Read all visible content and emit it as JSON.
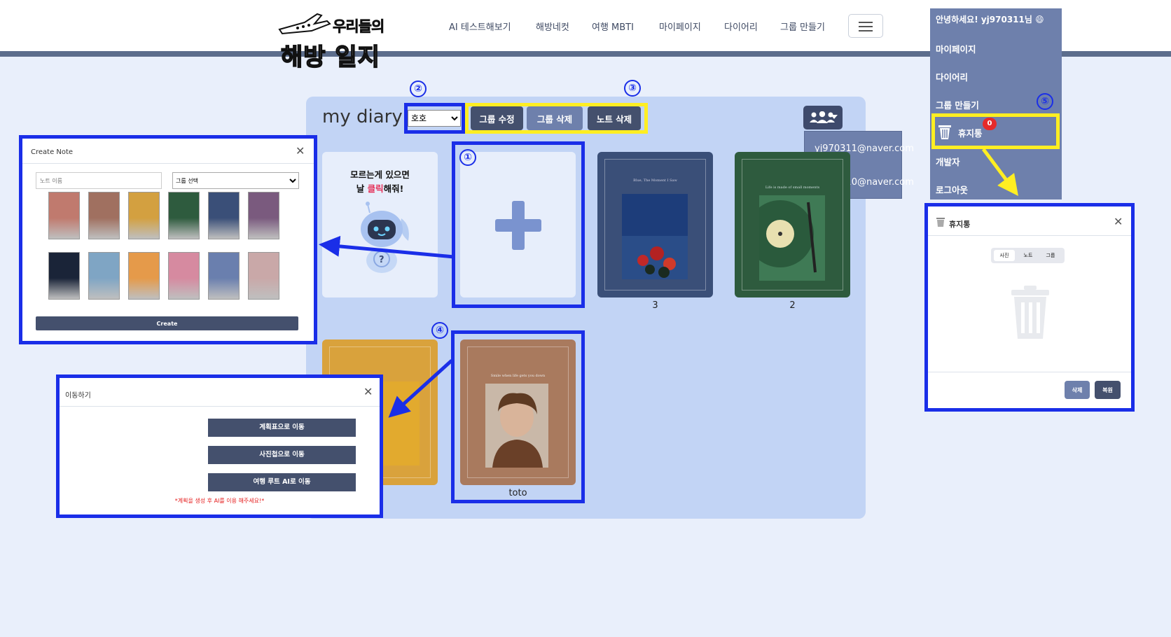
{
  "header": {
    "logo_line1": "우리들의",
    "logo_line2": "해방 일지",
    "nav": [
      "AI 테스트해보기",
      "해방네컷",
      "여행 MBTI",
      "마이페이지",
      "다이어리",
      "그룹 만들기"
    ]
  },
  "user_menu": {
    "greeting": "안녕하세요! yj970311님 😄",
    "items": [
      "마이페이지",
      "다이어리",
      "그룹 만들기",
      "휴지통",
      "개발자",
      "로그아웃"
    ],
    "trash_badge": "0"
  },
  "diary": {
    "title": "my diary",
    "group_select_value": "호호",
    "buttons": {
      "edit_group": "그룹 수정",
      "delete_group": "그룹 삭제",
      "delete_note": "노트 삭제"
    },
    "members": [
      "yj970311@naver.com",
      "kmy9810@naver.com"
    ],
    "helper_card": {
      "line1": "모르는게 있으면",
      "line2_pre": "날 ",
      "line2_hl": "클릭",
      "line2_post": "해줘!"
    },
    "notes": [
      {
        "caption": "3",
        "color": "#3a4f78",
        "small_text": "Blue, The Moment I Saw"
      },
      {
        "caption": "2",
        "color": "#2e5b3e",
        "small_text": "Life is made of small moments"
      },
      {
        "caption": "toto",
        "color": "#a97a5e",
        "small_text": "Smile when life gets you down"
      }
    ]
  },
  "annotations": [
    "①",
    "②",
    "③",
    "④",
    "⑤"
  ],
  "create_note_modal": {
    "title": "Create Note",
    "name_placeholder": "노트 이름",
    "group_placeholder": "그룹 선택",
    "create_label": "Create",
    "cover_colors": [
      "#c07a6e",
      "#a07060",
      "#d3a040",
      "#2e5b3e",
      "#3a4f78",
      "#7a5a7e",
      "#1a2438",
      "#7fa5c4",
      "#e59a4a",
      "#d68aa0",
      "#6a7fae",
      "#c9a8a8"
    ]
  },
  "move_modal": {
    "title": "이동하기",
    "buttons": [
      "계획표으로 이동",
      "사진첩으로 이동",
      "여행 루트 AI로 이동"
    ],
    "note": "*계획을 생성 후 AI를 이용 해주세요!*"
  },
  "trash_modal": {
    "title": "휴지통",
    "tabs": [
      "사진",
      "노트",
      "그룹"
    ],
    "delete_label": "삭제",
    "restore_label": "복원"
  }
}
